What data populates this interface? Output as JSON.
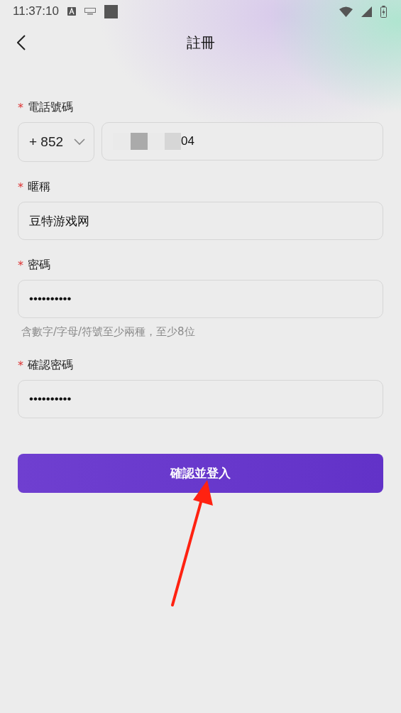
{
  "status_bar": {
    "time": "11:37:10"
  },
  "header": {
    "title": "註冊"
  },
  "fields": [
    {
      "kind": "phone",
      "required_mark": "*",
      "label": "電話號碼",
      "country_code": "+ 852",
      "value": "04"
    },
    {
      "kind": "text",
      "required_mark": "*",
      "label": "暱稱",
      "value": "豆特游戏网"
    },
    {
      "kind": "password",
      "required_mark": "*",
      "label": "密碼",
      "value": "••••••••••",
      "hint": "含數字/字母/符號至少兩種，至少8位"
    },
    {
      "kind": "password",
      "required_mark": "*",
      "label": "確認密碼",
      "value": "••••••••••"
    }
  ],
  "submit_button": {
    "label": "確認並登入"
  }
}
